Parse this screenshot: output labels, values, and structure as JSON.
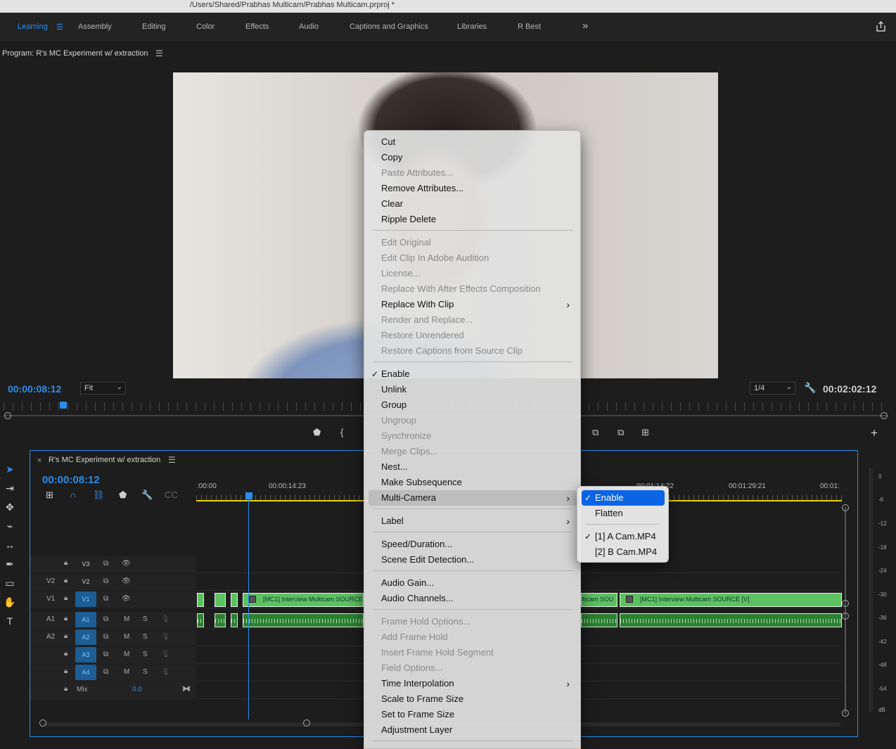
{
  "window": {
    "title": "/Users/Shared/Prabhas Multicam/Prabhas Multicam.prproj *"
  },
  "workspaces": [
    {
      "label": "Learning",
      "active": true
    },
    {
      "label": "Assembly"
    },
    {
      "label": "Editing"
    },
    {
      "label": "Color"
    },
    {
      "label": "Effects"
    },
    {
      "label": "Audio"
    },
    {
      "label": "Captions and Graphics"
    },
    {
      "label": "Libraries"
    },
    {
      "label": "R Best"
    }
  ],
  "program": {
    "title": "Program: R's MC Experiment w/ extraction",
    "timecode": "00:00:08:12",
    "fit": "Fit",
    "resolution": "1/4",
    "duration": "00:02:02:12"
  },
  "timeline": {
    "title": "R's MC Experiment w/ extraction",
    "timecode": "00:00:08:12",
    "ruler": [
      ":00:00",
      "00:00:14:23",
      "00:01:14:22",
      "00:01:29:21",
      "00:01:"
    ],
    "tracks_video": [
      {
        "src": "",
        "name": "V3"
      },
      {
        "src": "V2",
        "name": "V2"
      },
      {
        "src": "V1",
        "name": "V1"
      }
    ],
    "tracks_audio": [
      {
        "src": "A1",
        "name": "A1",
        "m": "M",
        "s": "S"
      },
      {
        "src": "A2",
        "name": "A2",
        "m": "M",
        "s": "S"
      },
      {
        "src": "",
        "name": "A3",
        "m": "M",
        "s": "S"
      },
      {
        "src": "",
        "name": "A4",
        "m": "M",
        "s": "S"
      }
    ],
    "mix": {
      "label": "Mix",
      "value": "0.0"
    },
    "clips": {
      "v1_left": "[MC1] Interview Multicam SOURCE",
      "v1_mid": "lticam SOU",
      "v1_right": "[MC1] Interview Multicam SOURCE  [V]"
    }
  },
  "meter": {
    "labels": [
      "0",
      "-6",
      "-12",
      "-18",
      "-24",
      "-30",
      "-36",
      "-42",
      "-48",
      "-54",
      "dB"
    ]
  },
  "context_menu": {
    "items": [
      {
        "label": "Cut"
      },
      {
        "label": "Copy"
      },
      {
        "label": "Paste Attributes...",
        "disabled": true
      },
      {
        "label": "Remove Attributes..."
      },
      {
        "label": "Clear"
      },
      {
        "label": "Ripple Delete"
      },
      {
        "label": "Edit Original",
        "disabled": true
      },
      {
        "label": "Edit Clip In Adobe Audition",
        "disabled": true
      },
      {
        "label": "License...",
        "disabled": true
      },
      {
        "label": "Replace With After Effects Composition",
        "disabled": true
      },
      {
        "label": "Replace With Clip",
        "submenu": true
      },
      {
        "label": "Render and Replace...",
        "disabled": true
      },
      {
        "label": "Restore Unrendered",
        "disabled": true
      },
      {
        "label": "Restore Captions from Source Clip",
        "disabled": true
      },
      {
        "label": "Enable",
        "checked": true
      },
      {
        "label": "Unlink"
      },
      {
        "label": "Group"
      },
      {
        "label": "Ungroup",
        "disabled": true
      },
      {
        "label": "Synchronize",
        "disabled": true
      },
      {
        "label": "Merge Clips...",
        "disabled": true
      },
      {
        "label": "Nest..."
      },
      {
        "label": "Make Subsequence"
      },
      {
        "label": "Multi-Camera",
        "submenu": true,
        "highlighted": true
      },
      {
        "label": "Label",
        "submenu": true
      },
      {
        "label": "Speed/Duration..."
      },
      {
        "label": "Scene Edit Detection..."
      },
      {
        "label": "Audio Gain..."
      },
      {
        "label": "Audio Channels..."
      },
      {
        "label": "Frame Hold Options...",
        "disabled": true
      },
      {
        "label": "Add Frame Hold",
        "disabled": true
      },
      {
        "label": "Insert Frame Hold Segment",
        "disabled": true
      },
      {
        "label": "Field Options...",
        "disabled": true
      },
      {
        "label": "Time Interpolation",
        "submenu": true
      },
      {
        "label": "Scale to Frame Size"
      },
      {
        "label": "Set to Frame Size"
      },
      {
        "label": "Adjustment Layer"
      }
    ]
  },
  "multicam_submenu": {
    "items": [
      {
        "label": "Enable",
        "checked": true,
        "selected": true
      },
      {
        "label": "Flatten"
      },
      {
        "label": "[1] A Cam.MP4",
        "checked": true
      },
      {
        "label": "[2] B Cam.MP4"
      }
    ]
  },
  "colors": {
    "accent": "#2d8ceb",
    "clip_video": "#5cc160",
    "clip_audio": "#2e7e33",
    "menu_select": "#0a64e4"
  }
}
